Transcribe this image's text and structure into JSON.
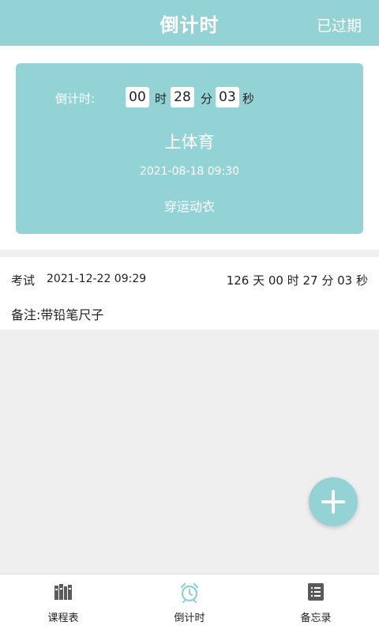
{
  "header": {
    "title": "倒计时",
    "expired_label": "已过期"
  },
  "current_event": {
    "countdown_label": "倒计时:",
    "hours": "00",
    "hours_unit": "时",
    "minutes": "28",
    "minutes_unit": "分",
    "seconds": "03",
    "seconds_unit": "秒",
    "title": "上体育",
    "datetime": "2021-08-18 09:30",
    "note": "穿运动衣"
  },
  "list": [
    {
      "type": "考试",
      "datetime": "2021-12-22 09:29",
      "countdown": "126 天 00 时 27 分 03 秒",
      "note": "备注:带铅笔尺子"
    }
  ],
  "fab": {
    "icon": "plus-icon"
  },
  "bottom_nav": [
    {
      "label": "课程表",
      "icon": "books-icon"
    },
    {
      "label": "倒计时",
      "icon": "alarm-clock-icon",
      "active": true
    },
    {
      "label": "备忘录",
      "icon": "notes-icon"
    }
  ],
  "colors": {
    "accent": "#94d3d5",
    "background": "#efefef",
    "card_text": "#ffffff",
    "text": "#222222"
  }
}
